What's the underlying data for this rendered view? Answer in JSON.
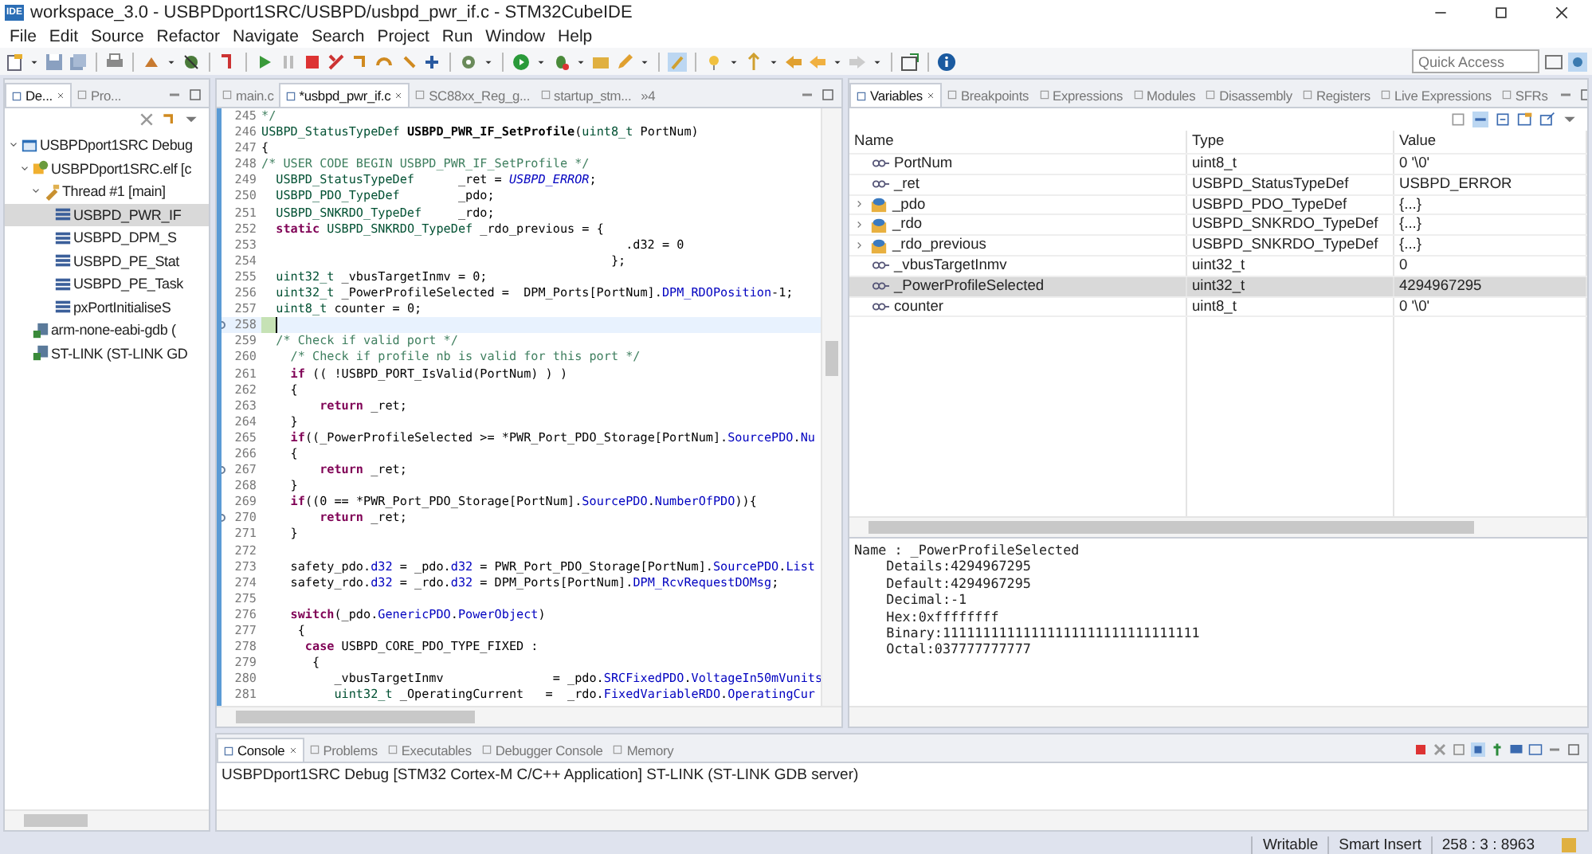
{
  "window": {
    "app_icon": "IDE",
    "title": "workspace_3.0 - USBPDport1SRC/USBPD/usbpd_pwr_if.c - STM32CubeIDE"
  },
  "menu": [
    "File",
    "Edit",
    "Source",
    "Refactor",
    "Navigate",
    "Search",
    "Project",
    "Run",
    "Window",
    "Help"
  ],
  "quick_access": {
    "placeholder": "Quick Access"
  },
  "left_tabs": [
    {
      "label": "De...",
      "selected": true
    },
    {
      "label": "Pro...",
      "selected": false
    }
  ],
  "debug_tree": [
    {
      "label": "USBPDport1SRC Debug",
      "kind": "launch",
      "selected": false,
      "expanded": true,
      "children": [
        {
          "label": "USBPDport1SRC.elf [c",
          "kind": "process",
          "selected": false,
          "expanded": true,
          "children": [
            {
              "label": "Thread #1 [main]",
              "kind": "thread",
              "selected": false,
              "expanded": true,
              "children": [
                {
                  "label": "USBPD_PWR_IF",
                  "kind": "frame",
                  "selected": true
                },
                {
                  "label": "USBPD_DPM_S",
                  "kind": "frame",
                  "selected": false
                },
                {
                  "label": "USBPD_PE_Stat",
                  "kind": "frame",
                  "selected": false
                },
                {
                  "label": "USBPD_PE_Task",
                  "kind": "frame",
                  "selected": false
                },
                {
                  "label": "pxPortInitialiseS",
                  "kind": "frame",
                  "selected": false
                }
              ]
            }
          ]
        },
        {
          "label": "arm-none-eabi-gdb (",
          "kind": "tool",
          "selected": false
        },
        {
          "label": "ST-LINK (ST-LINK GD",
          "kind": "tool",
          "selected": false
        }
      ]
    }
  ],
  "editor_tabs": [
    {
      "label": "main.c",
      "selected": false
    },
    {
      "label": "*usbpd_pwr_if.c",
      "selected": true
    },
    {
      "label": "SC88xx_Reg_g...",
      "selected": false
    },
    {
      "label": "startup_stm...",
      "selected": false
    }
  ],
  "editor_overflow": "»4",
  "code": [
    {
      "number": "245",
      "current": false,
      "marker": false,
      "segments": [
        {
          "text": "*/",
          "kind": "comment"
        }
      ]
    },
    {
      "number": "246",
      "current": false,
      "marker": false,
      "segments": [
        {
          "text": "USBPD_StatusTypeDef ",
          "kind": "type"
        },
        {
          "text": "USBPD_PWR_IF_SetProfile",
          "kind": "bold"
        },
        {
          "text": "(",
          "kind": "plain"
        },
        {
          "text": "uint8_t",
          "kind": "type"
        },
        {
          "text": " PortNum)",
          "kind": "plain"
        }
      ]
    },
    {
      "number": "247",
      "current": false,
      "marker": false,
      "segments": [
        {
          "text": "{",
          "kind": "plain"
        }
      ]
    },
    {
      "number": "248",
      "current": false,
      "marker": false,
      "segments": [
        {
          "text": "/* USER CODE BEGIN USBPD_PWR_IF_SetProfile */",
          "kind": "comment"
        }
      ]
    },
    {
      "number": "249",
      "current": false,
      "marker": false,
      "segments": [
        {
          "text": "  USBPD_StatusTypeDef",
          "kind": "type"
        },
        {
          "text": "      _ret = ",
          "kind": "plain"
        },
        {
          "text": "USBPD_ERROR",
          "kind": "enum"
        },
        {
          "text": ";",
          "kind": "plain"
        }
      ]
    },
    {
      "number": "250",
      "current": false,
      "marker": false,
      "segments": [
        {
          "text": "  USBPD_PDO_TypeDef",
          "kind": "type"
        },
        {
          "text": "        _pdo;",
          "kind": "plain"
        }
      ]
    },
    {
      "number": "251",
      "current": false,
      "marker": false,
      "segments": [
        {
          "text": "  USBPD_SNKRDO_TypeDef",
          "kind": "type"
        },
        {
          "text": "     _rdo;",
          "kind": "plain"
        }
      ]
    },
    {
      "number": "252",
      "current": false,
      "marker": false,
      "segments": [
        {
          "text": "  static",
          "kind": "keyword"
        },
        {
          "text": " USBPD_SNKRDO_TypeDef",
          "kind": "type"
        },
        {
          "text": " _rdo_previous = {",
          "kind": "plain"
        }
      ]
    },
    {
      "number": "253",
      "current": false,
      "marker": false,
      "segments": [
        {
          "text": "                                                  .d32 = 0",
          "kind": "plain"
        }
      ]
    },
    {
      "number": "254",
      "current": false,
      "marker": false,
      "segments": [
        {
          "text": "                                                };",
          "kind": "plain"
        }
      ]
    },
    {
      "number": "255",
      "current": false,
      "marker": false,
      "segments": [
        {
          "text": "  uint32_t",
          "kind": "type"
        },
        {
          "text": " _vbusTargetInmv = 0;",
          "kind": "plain"
        }
      ]
    },
    {
      "number": "256",
      "current": false,
      "marker": false,
      "segments": [
        {
          "text": "  uint32_t",
          "kind": "type"
        },
        {
          "text": " _PowerProfileSelected =  DPM_Ports[PortNum].",
          "kind": "plain"
        },
        {
          "text": "DPM_RDOPosition",
          "kind": "member"
        },
        {
          "text": "-1;",
          "kind": "plain"
        }
      ]
    },
    {
      "number": "257",
      "current": false,
      "marker": false,
      "segments": [
        {
          "text": "  uint8_t",
          "kind": "type"
        },
        {
          "text": " counter = 0;",
          "kind": "plain"
        }
      ]
    },
    {
      "number": "258",
      "current": true,
      "marker": true
    },
    {
      "number": "259",
      "current": false,
      "marker": false,
      "segments": [
        {
          "text": "  /* Check if valid port */",
          "kind": "comment"
        }
      ]
    },
    {
      "number": "260",
      "current": false,
      "marker": false,
      "segments": [
        {
          "text": "    /* Check if profile nb is valid for this port */",
          "kind": "comment"
        }
      ]
    },
    {
      "number": "261",
      "current": false,
      "marker": false,
      "segments": [
        {
          "text": "    if",
          "kind": "keyword"
        },
        {
          "text": " (( !USBPD_PORT_IsValid(PortNum) ) )",
          "kind": "plain"
        }
      ]
    },
    {
      "number": "262",
      "current": false,
      "marker": false,
      "segments": [
        {
          "text": "    {",
          "kind": "plain"
        }
      ]
    },
    {
      "number": "263",
      "current": false,
      "marker": false,
      "segments": [
        {
          "text": "        return",
          "kind": "keyword"
        },
        {
          "text": " _ret;",
          "kind": "plain"
        }
      ]
    },
    {
      "number": "264",
      "current": false,
      "marker": false,
      "segments": [
        {
          "text": "    }",
          "kind": "plain"
        }
      ]
    },
    {
      "number": "265",
      "current": false,
      "marker": false,
      "segments": [
        {
          "text": "    if",
          "kind": "keyword"
        },
        {
          "text": "((_PowerProfileSelected >= *PWR_Port_PDO_Storage[PortNum].",
          "kind": "plain"
        },
        {
          "text": "SourcePDO",
          "kind": "member"
        },
        {
          "text": ".",
          "kind": "plain"
        },
        {
          "text": "Nu",
          "kind": "member"
        }
      ]
    },
    {
      "number": "266",
      "current": false,
      "marker": false,
      "segments": [
        {
          "text": "    {",
          "kind": "plain"
        }
      ]
    },
    {
      "number": "267",
      "current": false,
      "marker": true,
      "segments": [
        {
          "text": "        return",
          "kind": "keyword"
        },
        {
          "text": " _ret;",
          "kind": "plain"
        }
      ]
    },
    {
      "number": "268",
      "current": false,
      "marker": false,
      "segments": [
        {
          "text": "    }",
          "kind": "plain"
        }
      ]
    },
    {
      "number": "269",
      "current": false,
      "marker": false,
      "segments": [
        {
          "text": "    if",
          "kind": "keyword"
        },
        {
          "text": "((0 == *PWR_Port_PDO_Storage[PortNum].",
          "kind": "plain"
        },
        {
          "text": "SourcePDO",
          "kind": "member"
        },
        {
          "text": ".",
          "kind": "plain"
        },
        {
          "text": "NumberOfPDO",
          "kind": "member"
        },
        {
          "text": ")){",
          "kind": "plain"
        }
      ]
    },
    {
      "number": "270",
      "current": false,
      "marker": true,
      "segments": [
        {
          "text": "        return",
          "kind": "keyword"
        },
        {
          "text": " _ret;",
          "kind": "plain"
        }
      ]
    },
    {
      "number": "271",
      "current": false,
      "marker": false,
      "segments": [
        {
          "text": "    }",
          "kind": "plain"
        }
      ]
    },
    {
      "number": "272",
      "current": false,
      "marker": false
    },
    {
      "number": "273",
      "current": false,
      "marker": false,
      "segments": [
        {
          "text": "    safety_pdo.",
          "kind": "plain"
        },
        {
          "text": "d32",
          "kind": "member"
        },
        {
          "text": " = _pdo.",
          "kind": "plain"
        },
        {
          "text": "d32",
          "kind": "member"
        },
        {
          "text": " = PWR_Port_PDO_Storage[PortNum].",
          "kind": "plain"
        },
        {
          "text": "SourcePDO",
          "kind": "member"
        },
        {
          "text": ".",
          "kind": "plain"
        },
        {
          "text": "List",
          "kind": "member"
        }
      ]
    },
    {
      "number": "274",
      "current": false,
      "marker": false,
      "segments": [
        {
          "text": "    safety_rdo.",
          "kind": "plain"
        },
        {
          "text": "d32",
          "kind": "member"
        },
        {
          "text": " = _rdo.",
          "kind": "plain"
        },
        {
          "text": "d32",
          "kind": "member"
        },
        {
          "text": " = DPM_Ports[PortNum].",
          "kind": "plain"
        },
        {
          "text": "DPM_RcvRequestDOMsg",
          "kind": "member"
        },
        {
          "text": ";",
          "kind": "plain"
        }
      ]
    },
    {
      "number": "275",
      "current": false,
      "marker": false
    },
    {
      "number": "276",
      "current": false,
      "marker": false,
      "segments": [
        {
          "text": "    switch",
          "kind": "keyword"
        },
        {
          "text": "(_pdo.",
          "kind": "plain"
        },
        {
          "text": "GenericPDO",
          "kind": "member"
        },
        {
          "text": ".",
          "kind": "plain"
        },
        {
          "text": "PowerObject",
          "kind": "member"
        },
        {
          "text": ")",
          "kind": "plain"
        }
      ]
    },
    {
      "number": "277",
      "current": false,
      "marker": false,
      "segments": [
        {
          "text": "     {",
          "kind": "plain"
        }
      ]
    },
    {
      "number": "278",
      "current": false,
      "marker": false,
      "segments": [
        {
          "text": "      case",
          "kind": "keyword"
        },
        {
          "text": " USBPD_CORE_PDO_TYPE_FIXED :",
          "kind": "plain"
        }
      ]
    },
    {
      "number": "279",
      "current": false,
      "marker": false,
      "segments": [
        {
          "text": "       {",
          "kind": "plain"
        }
      ]
    },
    {
      "number": "280",
      "current": false,
      "marker": false,
      "segments": [
        {
          "text": "          _vbusTargetInmv               = _pdo.",
          "kind": "plain"
        },
        {
          "text": "SRCFixedPDO",
          "kind": "member"
        },
        {
          "text": ".",
          "kind": "plain"
        },
        {
          "text": "VoltageIn50mVunits",
          "kind": "member"
        }
      ]
    },
    {
      "number": "281",
      "current": false,
      "marker": false,
      "segments": [
        {
          "text": "          uint32_t",
          "kind": "type"
        },
        {
          "text": " _OperatingCurrent   =  _rdo.",
          "kind": "plain"
        },
        {
          "text": "FixedVariableRDO",
          "kind": "member"
        },
        {
          "text": ".",
          "kind": "plain"
        },
        {
          "text": "OperatingCur",
          "kind": "member"
        }
      ]
    }
  ],
  "view_tabs": [
    {
      "label": "Variables",
      "selected": true
    },
    {
      "label": "Breakpoints",
      "selected": false
    },
    {
      "label": "Expressions",
      "selected": false
    },
    {
      "label": "Modules",
      "selected": false
    },
    {
      "label": "Disassembly",
      "selected": false
    },
    {
      "label": "Registers",
      "selected": false
    },
    {
      "label": "Live Expressions",
      "selected": false
    },
    {
      "label": "SFRs",
      "selected": false
    }
  ],
  "variables": {
    "columns": [
      "Name",
      "Type",
      "Value"
    ],
    "rows": [
      {
        "name": "PortNum",
        "type": "uint8_t",
        "value": "0 '\\0'",
        "expandable": false,
        "selected": false
      },
      {
        "name": "_ret",
        "type": "USBPD_StatusTypeDef",
        "value": "USBPD_ERROR",
        "expandable": false,
        "selected": false
      },
      {
        "name": "_pdo",
        "type": "USBPD_PDO_TypeDef",
        "value": "{...}",
        "expandable": true,
        "selected": false
      },
      {
        "name": "_rdo",
        "type": "USBPD_SNKRDO_TypeDef",
        "value": "{...}",
        "expandable": true,
        "selected": false
      },
      {
        "name": "_rdo_previous",
        "type": "USBPD_SNKRDO_TypeDef",
        "value": "{...}",
        "expandable": true,
        "selected": false
      },
      {
        "name": "_vbusTargetInmv",
        "type": "uint32_t",
        "value": "0",
        "expandable": false,
        "selected": false
      },
      {
        "name": "_PowerProfileSelected",
        "type": "uint32_t",
        "value": "4294967295",
        "expandable": false,
        "selected": true
      },
      {
        "name": "counter",
        "type": "uint8_t",
        "value": "0 '\\0'",
        "expandable": false,
        "selected": false
      }
    ]
  },
  "details": [
    "Name : _PowerProfileSelected",
    "    Details:4294967295",
    "    Default:4294967295",
    "    Decimal:-1",
    "    Hex:0xffffffff",
    "    Binary:11111111111111111111111111111111",
    "    Octal:037777777777"
  ],
  "console_tabs": [
    {
      "label": "Console",
      "selected": true
    },
    {
      "label": "Problems",
      "selected": false
    },
    {
      "label": "Executables",
      "selected": false
    },
    {
      "label": "Debugger Console",
      "selected": false
    },
    {
      "label": "Memory",
      "selected": false
    }
  ],
  "console_text": "USBPDport1SRC Debug [STM32 Cortex-M C/C++ Application] ST-LINK (ST-LINK GDB server)",
  "status_bar": [
    "Writable",
    "Smart Insert",
    "258 : 3 : 8963"
  ]
}
